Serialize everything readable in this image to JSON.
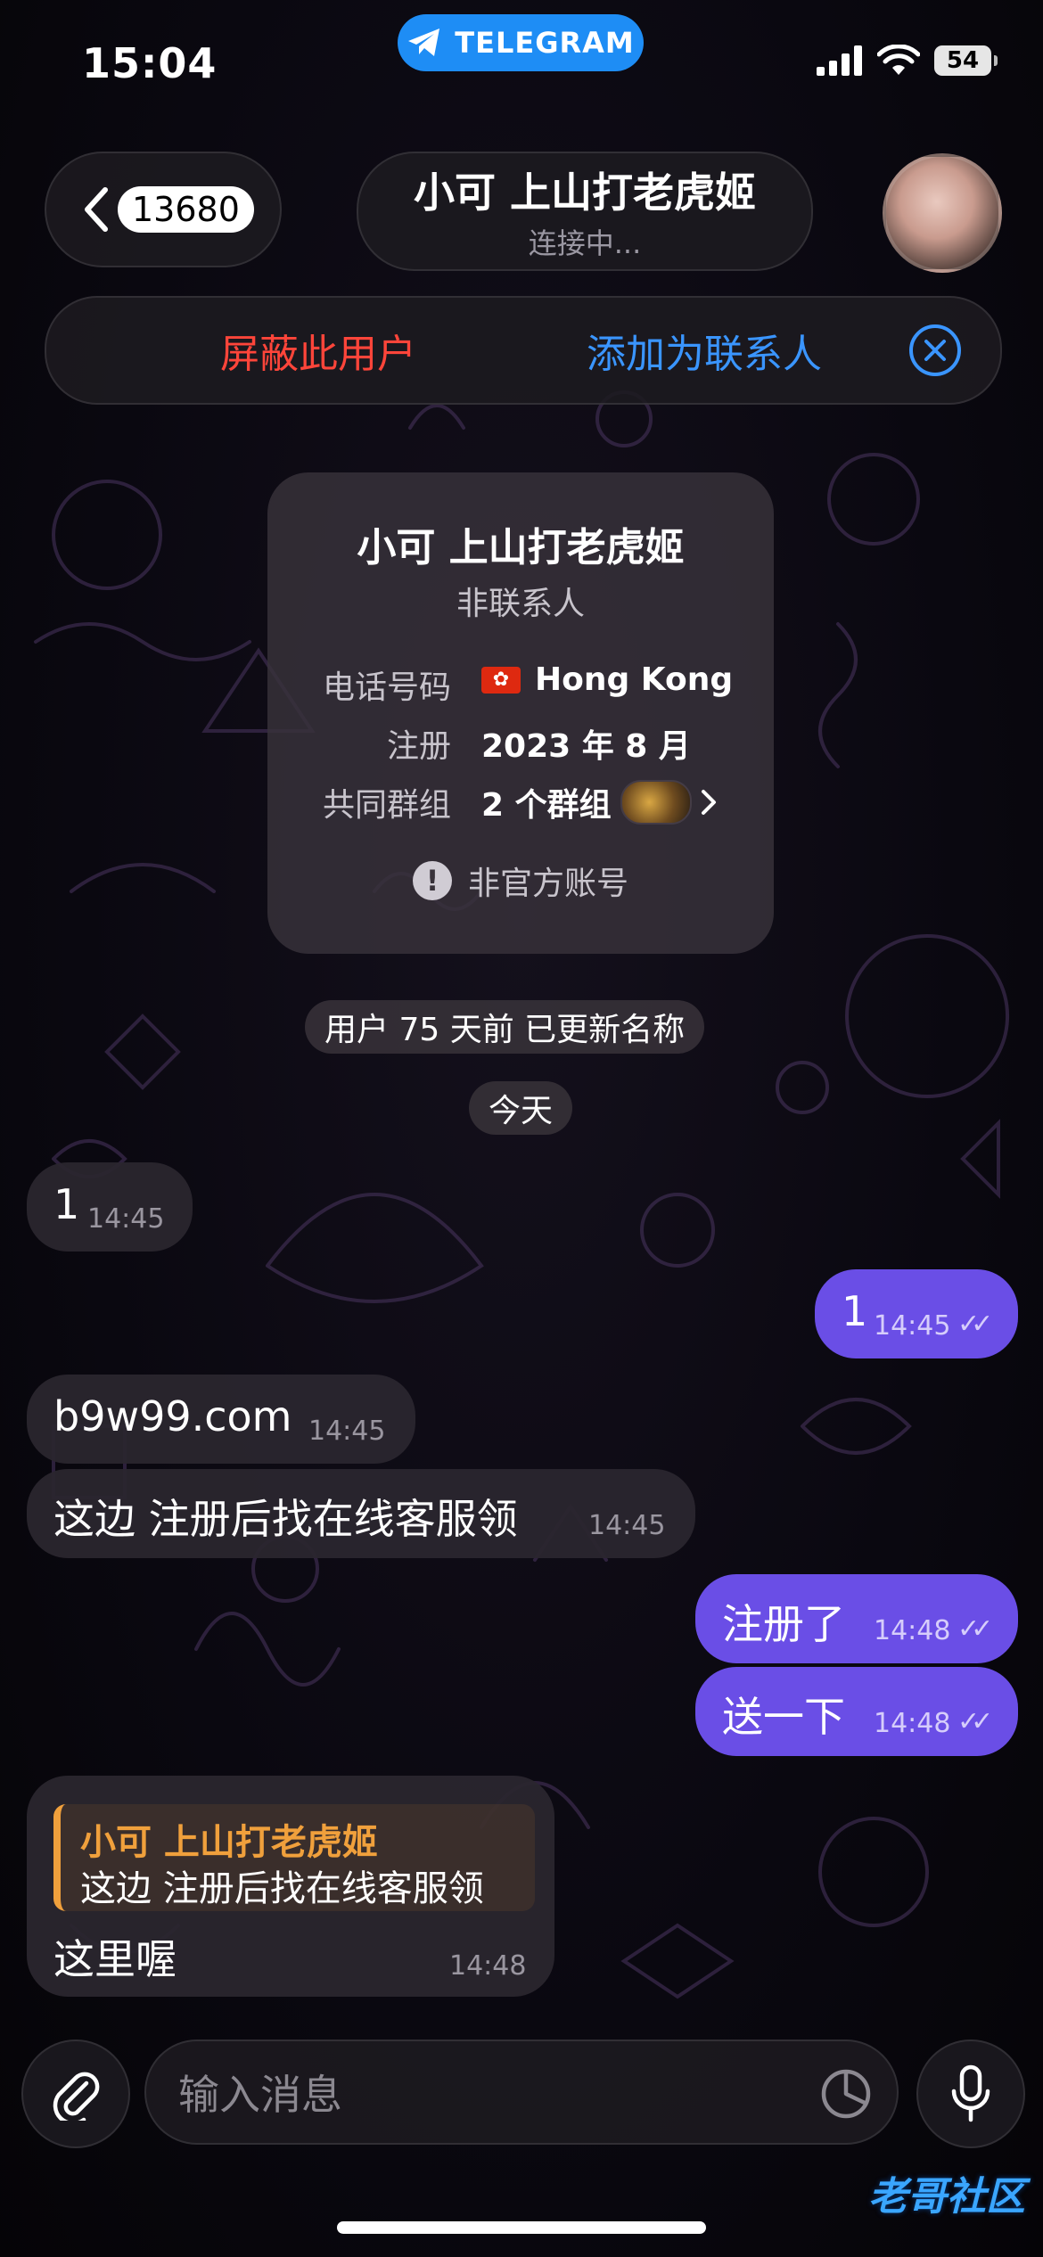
{
  "status_bar": {
    "time": "15:04",
    "app_pill": "TELEGRAM",
    "battery": "54"
  },
  "header": {
    "back_count": "13680",
    "chat_title": "小可 上山打老虎姬",
    "chat_status": "连接中..."
  },
  "action_bar": {
    "block_label": "屏蔽此用户",
    "add_contact_label": "添加为联系人"
  },
  "info_card": {
    "name": "小可 上山打老虎姬",
    "status": "非联系人",
    "rows": [
      {
        "label": "电话号码",
        "value": "Hong Kong"
      },
      {
        "label": "注册",
        "value": "2023 年 8 月"
      },
      {
        "label": "共同群组",
        "value": "2 个群组"
      }
    ],
    "unofficial": "非官方账号"
  },
  "service": {
    "name_change": "用户 75 天前 已更新名称",
    "date_divider": "今天"
  },
  "messages": [
    {
      "dir": "in",
      "text": "1",
      "time": "14:45"
    },
    {
      "dir": "out",
      "text": "1",
      "time": "14:45"
    },
    {
      "dir": "in",
      "text": "b9w99.com",
      "time": "14:45"
    },
    {
      "dir": "in",
      "text": "这边 注册后找在线客服领",
      "time": "14:45"
    },
    {
      "dir": "out",
      "text": "注册了",
      "time": "14:48"
    },
    {
      "dir": "out",
      "text": "送一下",
      "time": "14:48"
    },
    {
      "dir": "in",
      "reply_name": "小可 上山打老虎姬",
      "reply_text": "这边 注册后找在线客服领",
      "text": "这里喔",
      "time": "14:48"
    }
  ],
  "input": {
    "placeholder": "输入消息"
  },
  "watermark": "老哥社区",
  "colors": {
    "accent_blue": "#3a95ff",
    "danger_red": "#ff453a",
    "outgoing_bubble": "#6a4ee6",
    "reply_orange": "#f0a03c"
  }
}
